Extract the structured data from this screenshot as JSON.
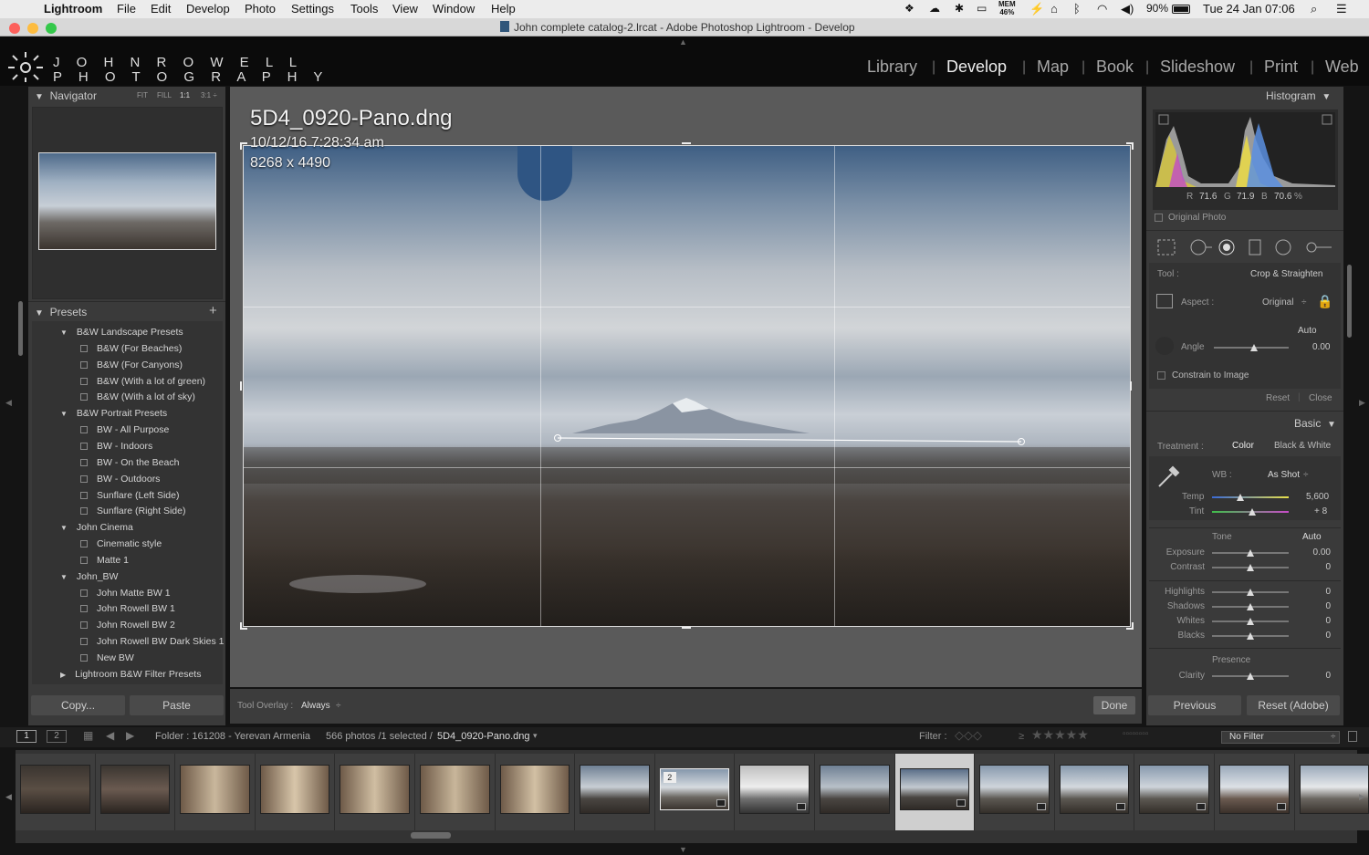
{
  "menubar": {
    "app": "Lightroom",
    "items": [
      "File",
      "Edit",
      "Develop",
      "Photo",
      "Settings",
      "Tools",
      "View",
      "Window",
      "Help"
    ],
    "mem": "MEM",
    "mem_pct": "46%",
    "battery": "90%",
    "clock": "Tue 24 Jan  07:06"
  },
  "window": {
    "title": "John complete catalog-2.lrcat - Adobe Photoshop Lightroom - Develop"
  },
  "identity": {
    "line1": "J O H N    R O W E L L",
    "line2": "P H O T O G R A P H Y",
    "modules": [
      "Library",
      "Develop",
      "Map",
      "Book",
      "Slideshow",
      "Print",
      "Web"
    ],
    "active": "Develop"
  },
  "navigator": {
    "title": "Navigator",
    "zoom": [
      "FIT",
      "FILL",
      "1:1",
      "3:1 ÷"
    ]
  },
  "presets": {
    "title": "Presets",
    "add": "+",
    "items": [
      {
        "label": "B&W Landscape Presets",
        "folder": true
      },
      {
        "label": "B&W (For Beaches)"
      },
      {
        "label": "B&W (For Canyons)"
      },
      {
        "label": "B&W (With a lot of green)"
      },
      {
        "label": "B&W (With a lot of sky)"
      },
      {
        "label": "B&W Portrait Presets",
        "folder": true
      },
      {
        "label": "BW - All Purpose"
      },
      {
        "label": "BW - Indoors"
      },
      {
        "label": "BW - On the Beach"
      },
      {
        "label": "BW - Outdoors"
      },
      {
        "label": "Sunflare (Left Side)"
      },
      {
        "label": "Sunflare (Right Side)"
      },
      {
        "label": "John Cinema",
        "folder": true
      },
      {
        "label": "Cinematic style"
      },
      {
        "label": "Matte 1"
      },
      {
        "label": "John_BW",
        "folder": true
      },
      {
        "label": "John Matte BW 1"
      },
      {
        "label": "John Rowell BW 1"
      },
      {
        "label": "John Rowell BW 2"
      },
      {
        "label": "John Rowell BW Dark Skies 1"
      },
      {
        "label": "New BW"
      },
      {
        "label": "Lightroom B&W Filter Presets",
        "folder": true,
        "collapsed": true
      }
    ]
  },
  "left_buttons": {
    "copy": "Copy...",
    "paste": "Paste"
  },
  "image": {
    "filename": "5D4_0920-Pano.dng",
    "datetime": "10/12/16 7:28:34 am",
    "dimensions": "8268 x 4490"
  },
  "toolbar": {
    "overlay_label": "Tool Overlay :",
    "overlay_value": "Always",
    "done": "Done"
  },
  "histogram": {
    "title": "Histogram",
    "r_label": "R",
    "r": "71.6",
    "g_label": "G",
    "g": "71.9",
    "b_label": "B",
    "b": "70.6",
    "pct": "%",
    "original": "Original Photo"
  },
  "crop": {
    "tool_label": "Tool :",
    "tool_value": "Crop & Straighten",
    "aspect_label": "Aspect :",
    "aspect_value": "Original",
    "auto": "Auto",
    "angle_label": "Angle",
    "angle_value": "0.00",
    "constrain": "Constrain to Image",
    "reset": "Reset",
    "close": "Close"
  },
  "basic": {
    "title": "Basic",
    "treatment_label": "Treatment :",
    "color": "Color",
    "bw": "Black & White",
    "wb_label": "WB :",
    "wb_value": "As Shot",
    "temp_label": "Temp",
    "temp": "5,600",
    "tint_label": "Tint",
    "tint": "+ 8",
    "tone": "Tone",
    "tone_auto": "Auto",
    "exposure_label": "Exposure",
    "exposure": "0.00",
    "contrast_label": "Contrast",
    "contrast": "0",
    "highlights_label": "Highlights",
    "highlights": "0",
    "shadows_label": "Shadows",
    "shadows": "0",
    "whites_label": "Whites",
    "whites": "0",
    "blacks_label": "Blacks",
    "blacks": "0",
    "presence": "Presence",
    "clarity_label": "Clarity",
    "clarity": "0"
  },
  "right_buttons": {
    "previous": "Previous",
    "reset": "Reset (Adobe)"
  },
  "filmstrip": {
    "view1": "1",
    "view2": "2",
    "folder": "Folder : 161208 - Yerevan Armenia",
    "count": "566 photos /1 selected /",
    "selected": "5D4_0920-Pano.dng",
    "filter_label": "Filter :",
    "filter_value": "No Filter",
    "stack_badge": "2",
    "ge": "≥"
  },
  "colors": {
    "accent_select": "#c8c8c8",
    "panel": "#3a3a3a",
    "bg": "#141414"
  }
}
